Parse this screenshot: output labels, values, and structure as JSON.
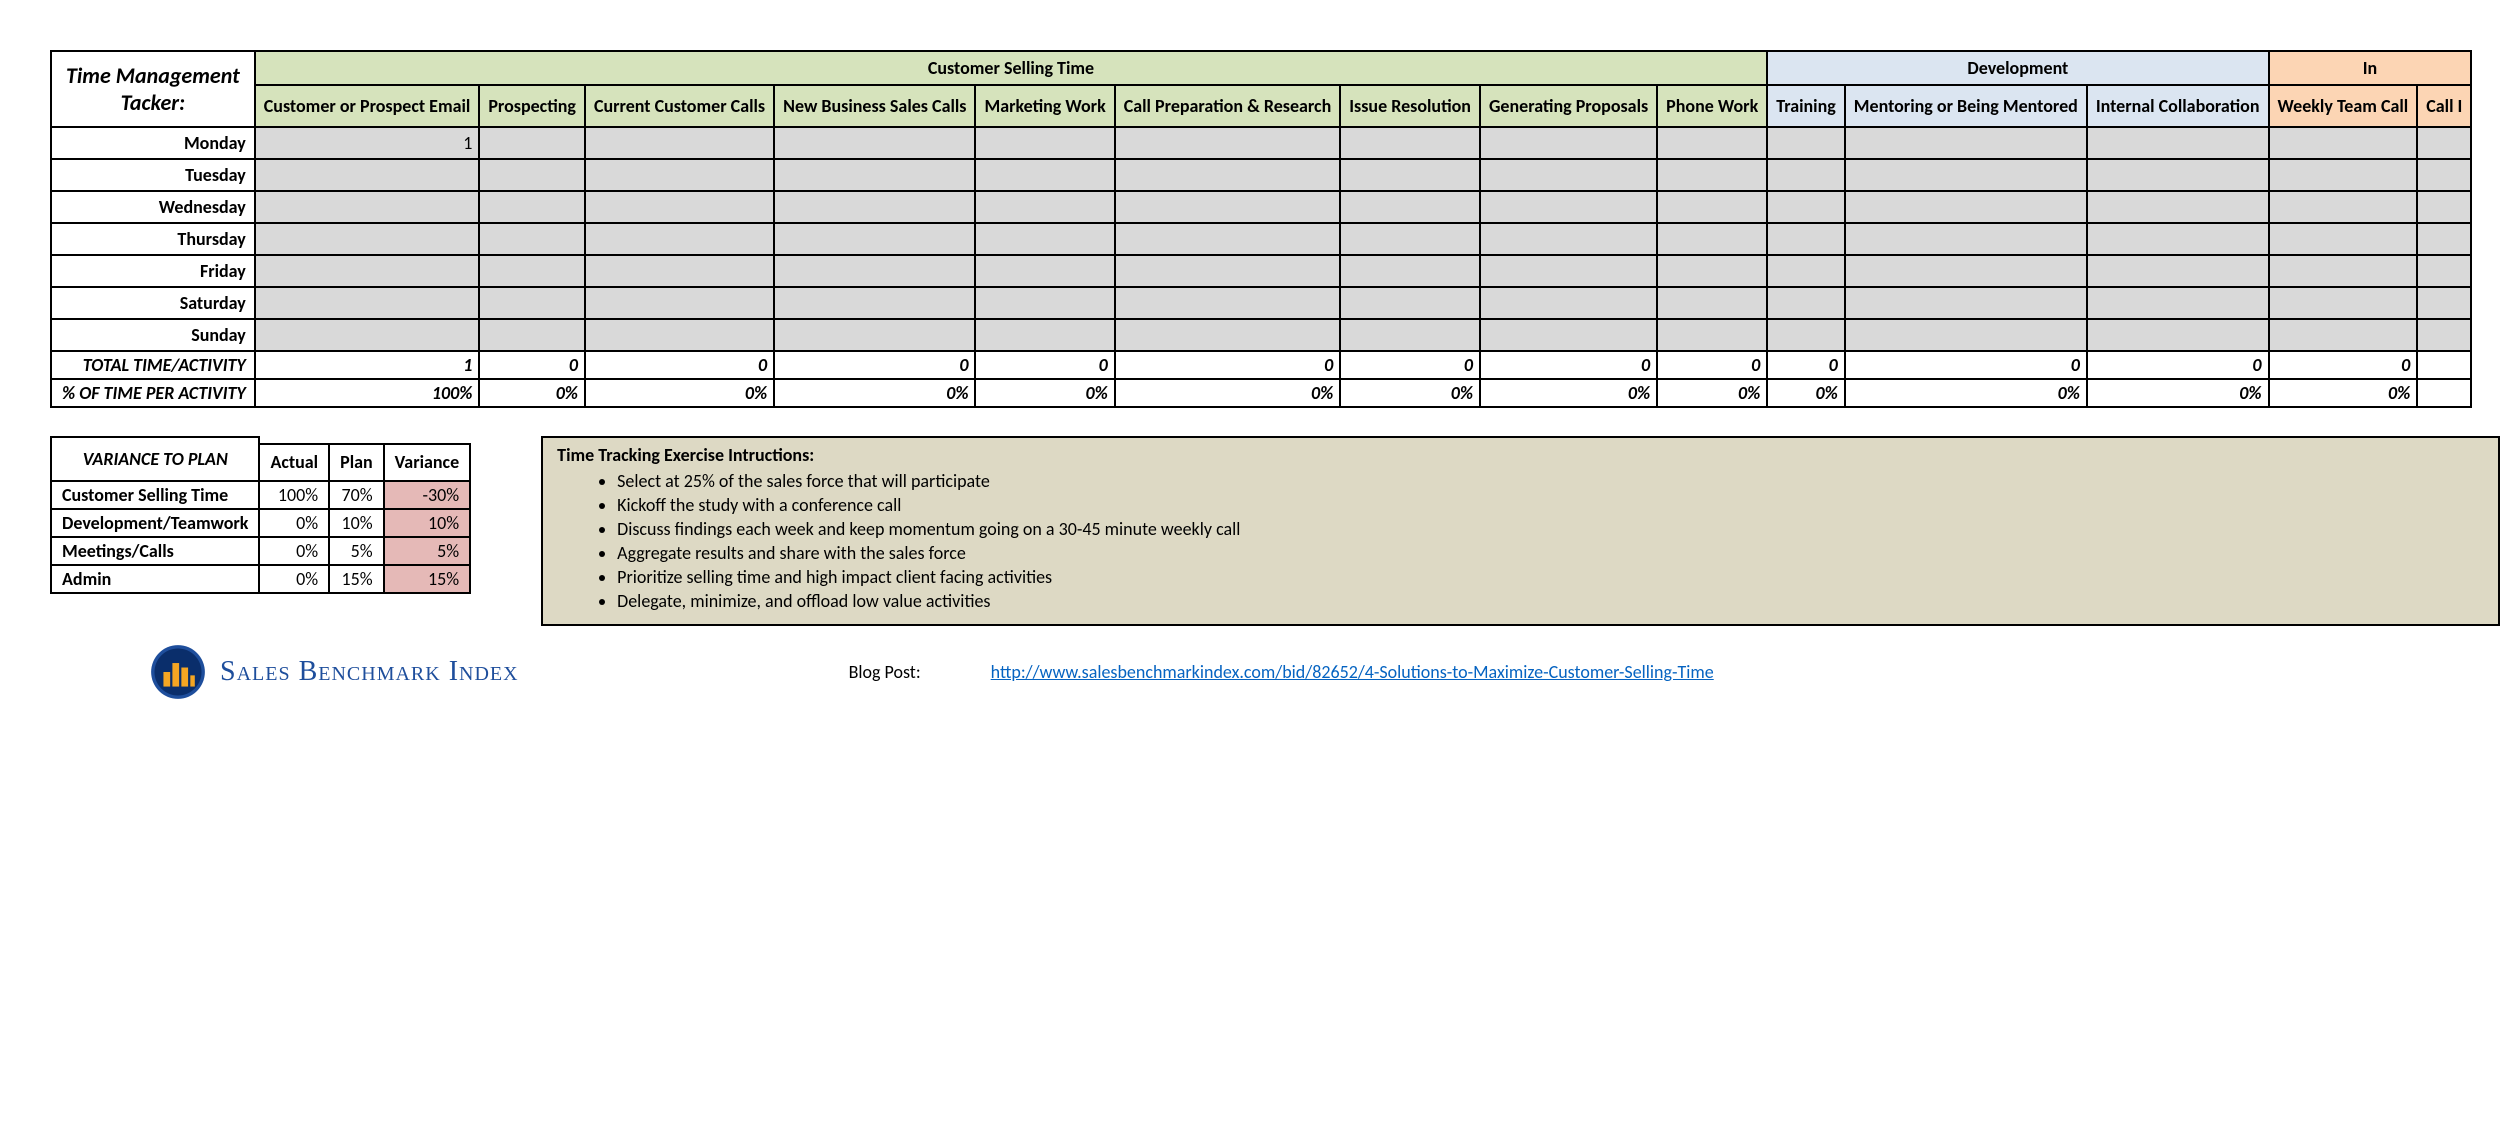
{
  "main": {
    "corner": "Time Management\nTacker:",
    "groups": [
      "Customer Selling Time",
      "Development",
      "In"
    ],
    "cols": [
      "Customer or Prospect Email",
      "Prospecting",
      "Current Customer Calls",
      "New Business Sales Calls",
      "Marketing Work",
      "Call Preparation & Research",
      "Issue Resolution",
      "Generating Proposals",
      "Phone Work",
      "Training",
      "Mentoring or Being Mentored",
      "Internal Collaboration",
      "Weekly Team Call",
      "Call I"
    ],
    "days": [
      "Monday",
      "Tuesday",
      "Wednesday",
      "Thursday",
      "Friday",
      "Saturday",
      "Sunday"
    ],
    "day_values": {
      "Monday": [
        "1",
        "",
        "",
        "",
        "",
        "",
        "",
        "",
        "",
        "",
        "",
        "",
        "",
        ""
      ]
    },
    "total_label": "TOTAL TIME/ACTIVITY",
    "totals": [
      "1",
      "0",
      "0",
      "0",
      "0",
      "0",
      "0",
      "0",
      "0",
      "0",
      "0",
      "0",
      "0",
      ""
    ],
    "pct_label": "% OF TIME PER ACTIVITY",
    "pcts": [
      "100%",
      "0%",
      "0%",
      "0%",
      "0%",
      "0%",
      "0%",
      "0%",
      "0%",
      "0%",
      "0%",
      "0%",
      "0%",
      ""
    ]
  },
  "variance": {
    "title": "VARIANCE TO PLAN",
    "headers": [
      "Actual",
      "Plan",
      "Variance"
    ],
    "rows": [
      {
        "label": "Customer Selling Time",
        "actual": "100%",
        "plan": "70%",
        "variance": "-30%"
      },
      {
        "label": "Development/Teamwork",
        "actual": "0%",
        "plan": "10%",
        "variance": "10%"
      },
      {
        "label": "Meetings/Calls",
        "actual": "0%",
        "plan": "5%",
        "variance": "5%"
      },
      {
        "label": "Admin",
        "actual": "0%",
        "plan": "15%",
        "variance": "15%"
      }
    ]
  },
  "instructions": {
    "title": "Time Tracking Exercise Intructions:",
    "items": [
      "Select at 25% of the sales force that will participate",
      "Kickoff the study with a conference call",
      "Discuss findings each week and keep momentum going on a 30-45 minute weekly call",
      "Aggregate results and share with the sales force",
      "Prioritize selling time and high impact client facing activities",
      "Delegate, minimize, and offload low value activities"
    ]
  },
  "brand": "Sales Benchmark Index",
  "blog": {
    "label": "Blog Post:",
    "url": "http://www.salesbenchmarkindex.com/bid/82652/4-Solutions-to-Maximize-Customer-Selling-Time"
  }
}
